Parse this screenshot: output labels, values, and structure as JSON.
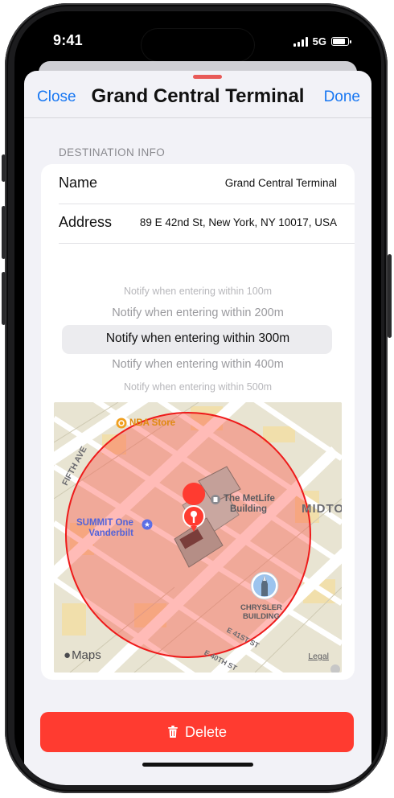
{
  "status": {
    "time": "9:41",
    "network": "5G"
  },
  "nav": {
    "close": "Close",
    "title": "Grand Central Terminal",
    "done": "Done"
  },
  "section": {
    "header": "DESTINATION INFO"
  },
  "info": {
    "name_label": "Name",
    "name_value": "Grand Central Terminal",
    "address_label": "Address",
    "address_value": "89 E 42nd St, New York, NY 10017, USA"
  },
  "picker": {
    "options": [
      "Notify when entering within 100m",
      "Notify when entering within 200m",
      "Notify when entering within 300m",
      "Notify when entering within 400m",
      "Notify when entering within 500m"
    ],
    "selected": "Notify when entering within 300m"
  },
  "map": {
    "labels": {
      "nba_store": "NBA Store",
      "fifth_ave": "FIFTH AVE",
      "metlife": [
        "The MetLife",
        "Building"
      ],
      "midtown": "MIDTO",
      "summit": [
        "SUMMIT One",
        "Vanderbilt"
      ],
      "chrysler": [
        "CHRYSLER",
        "BUILDING"
      ],
      "e41": "E 41ST ST",
      "e40": "E 40TH ST",
      "attribution": "Maps",
      "legal": "Legal"
    },
    "geofence_color": "#ff3b30"
  },
  "delete_button": {
    "label": "Delete",
    "color": "#ff3b30"
  }
}
